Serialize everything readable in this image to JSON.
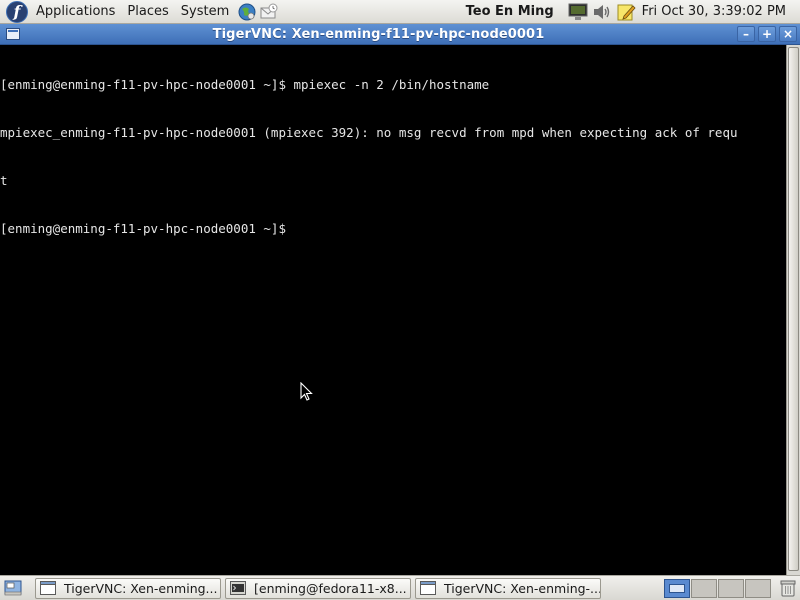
{
  "top_panel": {
    "menus": [
      "Applications",
      "Places",
      "System"
    ],
    "user_name": "Teo En Ming",
    "clock": "Fri Oct 30,  3:39:02 PM"
  },
  "window": {
    "title": "TigerVNC: Xen-enming-f11-pv-hpc-node0001",
    "buttons": {
      "minimize": "–",
      "maximize": "+",
      "close": "×"
    }
  },
  "terminal": {
    "lines": [
      "[enming@enming-f11-pv-hpc-node0001 ~]$ mpiexec -n 2 /bin/hostname",
      "mpiexec_enming-f11-pv-hpc-node0001 (mpiexec 392): no msg recvd from mpd when expecting ack of requ",
      "t",
      "[enming@enming-f11-pv-hpc-node0001 ~]$"
    ]
  },
  "taskbar": {
    "tasks": [
      {
        "label": "TigerVNC: Xen-enming...",
        "icon": "window-icon"
      },
      {
        "label": "[enming@fedora11-x8...",
        "icon": "terminal-icon"
      },
      {
        "label": "TigerVNC: Xen-enming-...",
        "icon": "window-icon"
      }
    ]
  },
  "colors": {
    "title_bar": "#4a7cc3",
    "terminal_bg": "#000000",
    "panel": "#e6e5e0"
  }
}
